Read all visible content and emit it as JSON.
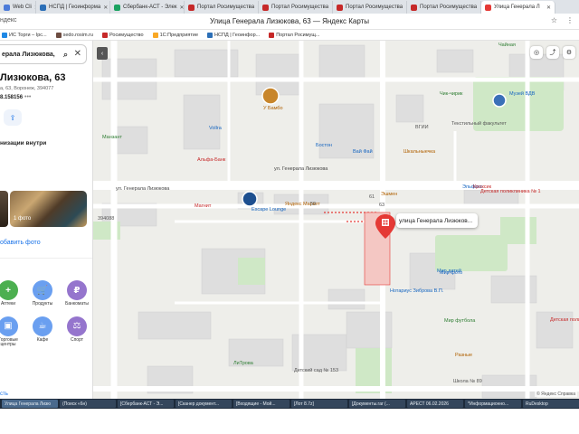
{
  "browser": {
    "address_fragment": "ндекс",
    "title": "Улица Генерала Лизюкова, 63 — Яндекс Карты",
    "tabs": [
      {
        "label": "Web Cli",
        "color": "#4c7bd9"
      },
      {
        "label": "НСПД | Геоинформа",
        "color": "#2c6fb7"
      },
      {
        "label": "Сбербанк-АСТ - Элек",
        "color": "#1aa260"
      },
      {
        "label": "Портал Росимущества",
        "color": "#c62828"
      },
      {
        "label": "Портал Росимущества",
        "color": "#c62828"
      },
      {
        "label": "Портал Росимущества",
        "color": "#c62828"
      },
      {
        "label": "Портал Росимущества",
        "color": "#c62828"
      },
      {
        "label": "Улица Генерала Л",
        "color": "#e53935",
        "active": true
      }
    ],
    "bookmarks": [
      {
        "label": "ИС Торги – Ipc...",
        "color": "#1e88e5"
      },
      {
        "label": "sedo.rosim.ru",
        "color": "#6d4c41"
      },
      {
        "label": "Росимущество",
        "color": "#c62828"
      },
      {
        "label": "1С:Предприятие",
        "color": "#f9a825"
      },
      {
        "label": "НСПД | Геоинфор...",
        "color": "#2c6fb7"
      },
      {
        "label": "Портал Росимущ...",
        "color": "#c62828"
      }
    ]
  },
  "panel": {
    "search_value": "ерала Лизюкова,",
    "place_title": "Лизюкова, 63",
    "place_address": "а, 63, Воронеж, 394077",
    "phone": "8.158156",
    "more": "•••",
    "orgs_inside": "низации внутри",
    "photo_count": "1 фото",
    "add_photo": "обавить фото",
    "categories": [
      {
        "label": "Аптеки",
        "color": "#4caf50",
        "glyph": "+"
      },
      {
        "label": "Продукты",
        "color": "#6a9ff0",
        "glyph": "🛒"
      },
      {
        "label": "Банкоматы",
        "color": "#9575cd",
        "glyph": "₽"
      },
      {
        "label": "Торговые центры",
        "color": "#6a9ff0",
        "glyph": "▣"
      },
      {
        "label": "Кафе",
        "color": "#6a9ff0",
        "glyph": "☕"
      },
      {
        "label": "Спорт",
        "color": "#9575cd",
        "glyph": "⚖"
      }
    ],
    "bottom_link": "сть"
  },
  "map": {
    "callout": "улица Генерала Лизюков...",
    "labels": [
      {
        "t": "Чайная",
        "c": "#2e7d32"
      },
      {
        "t": "У Бамбо",
        "c": "#b06000"
      },
      {
        "t": "Vollra",
        "c": "#1565c0"
      },
      {
        "t": "Манзант",
        "c": "#2e7d32"
      },
      {
        "t": "Альфа-Банк",
        "c": "#c62828"
      },
      {
        "t": "Бостон",
        "c": "#1565c0"
      },
      {
        "t": "Вай Фай",
        "c": "#1565c0"
      },
      {
        "t": "ВГИИ",
        "c": "#555"
      },
      {
        "t": "Текстильный факультет",
        "c": "#555"
      },
      {
        "t": "Шкальныечка",
        "c": "#b06000"
      },
      {
        "t": "Музей ВДВ",
        "c": "#1565c0"
      },
      {
        "t": "Чик-чирик",
        "c": "#2e7d32"
      },
      {
        "t": "ул. Генерала Лизюкова",
        "c": "#444"
      },
      {
        "t": "Эшмен",
        "c": "#b06000"
      },
      {
        "t": "Escape Lounge",
        "c": "#1565c0"
      },
      {
        "t": "Яндекс Маркет",
        "c": "#b06000"
      },
      {
        "t": "Магнит",
        "c": "#c62828"
      },
      {
        "t": "Эльфокс",
        "c": "#1565c0"
      },
      {
        "t": "Кроксик",
        "c": "#c62828"
      },
      {
        "t": "Детская поликлиника № 1",
        "c": "#c62828"
      },
      {
        "t": "Мир детей",
        "c": "#1565c0"
      },
      {
        "t": "Мир фото",
        "c": "#1565c0"
      },
      {
        "t": "Мир футбола",
        "c": "#2e7d32"
      },
      {
        "t": "Нотариус Зиброва В.П.",
        "c": "#1565c0"
      },
      {
        "t": "ЛиТрова",
        "c": "#2e7d32"
      },
      {
        "t": "Детский сад № 153",
        "c": "#555"
      },
      {
        "t": "Детская поликлиника № 1",
        "c": "#c62828"
      },
      {
        "t": "Школа № 89",
        "c": "#555"
      },
      {
        "t": "Разные",
        "c": "#b06000"
      },
      {
        "t": "394088",
        "c": "#555"
      },
      {
        "t": "63",
        "c": "#555"
      },
      {
        "t": "61",
        "c": "#555"
      },
      {
        "t": "59",
        "c": "#555"
      },
      {
        "t": "ул. Генерала Лизюкова",
        "c": "#444"
      }
    ],
    "copyright": "© Яндекс  Справка"
  },
  "taskbar": [
    "Улица Генерала Лизю",
    "(Поиск «6н)",
    "[Сбербанк-АСТ - Э...",
    "[Сканер документ...",
    "[Входящие - Мой...",
    "[Лот 8.7z]",
    "[Документы.rar (...",
    "АРЕСТ 06.02.2026",
    "*Информационно...",
    "RuDesktop"
  ]
}
